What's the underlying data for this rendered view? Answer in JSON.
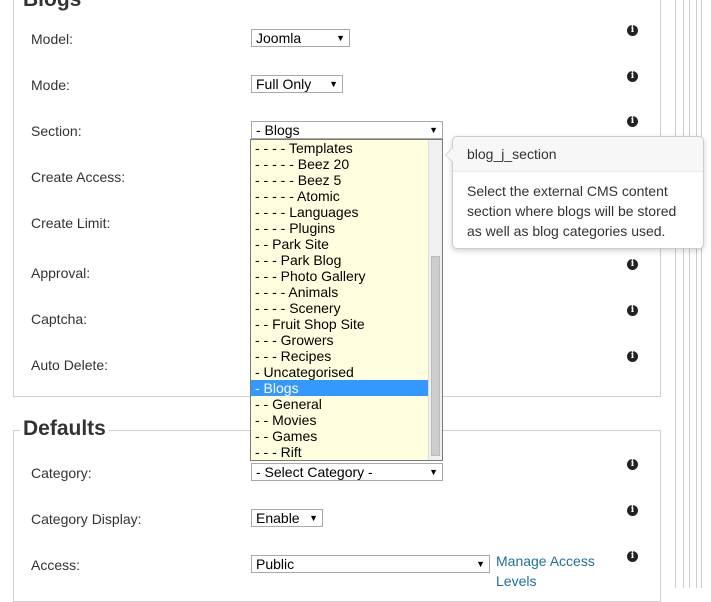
{
  "sections": {
    "blogs_legend": "Blogs",
    "defaults_legend": "Defaults"
  },
  "blogs": {
    "model_label": "Model:",
    "model_value": "Joomla",
    "mode_label": "Mode:",
    "mode_value": "Full Only",
    "section_label": "Section:",
    "section_value": "- Blogs",
    "create_access_label": "Create Access:",
    "create_limit_label": "Create Limit:",
    "approval_label": "Approval:",
    "captcha_label": "Captcha:",
    "auto_delete_label": "Auto Delete:"
  },
  "section_options": [
    "- - - - Templates",
    "- - - - - Beez 20",
    "- - - - - Beez 5",
    "- - - - - Atomic",
    "- - - - Languages",
    "- - - - Plugins",
    "- - Park Site",
    "- - - Park Blog",
    "- - - Photo Gallery",
    "- - - - Animals",
    "- - - - Scenery",
    "- - Fruit Shop Site",
    "- - - Growers",
    "- - - Recipes",
    "- Uncategorised",
    "- Blogs",
    "- - General",
    "- - Movies",
    "- - Games",
    "- - - Rift"
  ],
  "section_selected_index": 15,
  "tooltip": {
    "title": "blog_j_section",
    "body": "Select the external CMS content section where blogs will be stored as well as blog categories used."
  },
  "defaults": {
    "category_label": "Category:",
    "category_value": "- Select Category -",
    "category_display_label": "Category Display:",
    "category_display_value": "Enable",
    "access_label": "Access:",
    "access_value": "Public",
    "manage_access_link": "Manage Access Levels"
  },
  "icons": {
    "info": "info-icon",
    "dropdown_arrow": "chevron-down-icon"
  },
  "glyphs": {
    "info": "i",
    "arrow": "▼"
  }
}
